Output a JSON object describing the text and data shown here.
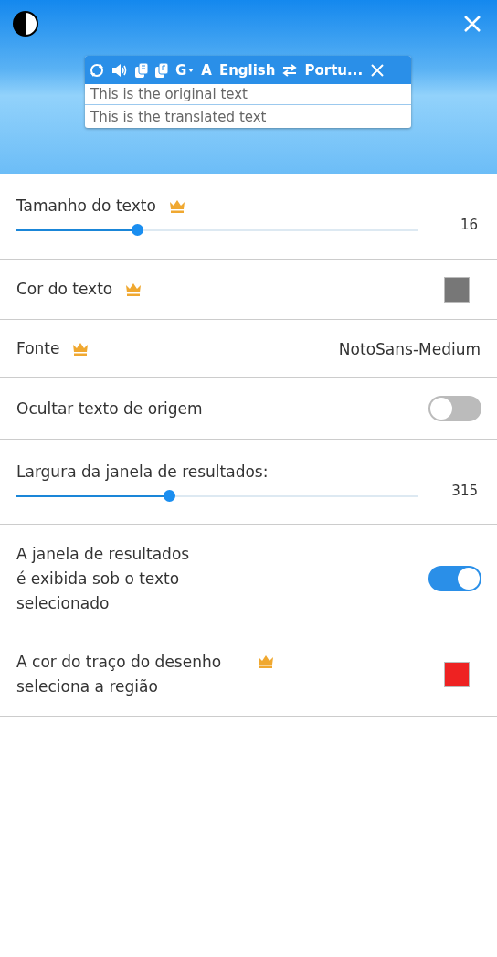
{
  "header": {
    "preview": {
      "toolbar": {
        "engine": "G",
        "font_button": "A",
        "source_language": "English",
        "target_language": "Portu..."
      },
      "original_text": "This is the original text",
      "translated_text": "This is the translated text"
    }
  },
  "settings": [
    {
      "kind": "slider",
      "label": "Tamanho do texto",
      "premium": true,
      "level": 0.3,
      "reading": "16"
    },
    {
      "kind": "color",
      "label": "Cor do texto",
      "premium": true,
      "color": "#777777"
    },
    {
      "kind": "value",
      "label": "Fonte",
      "premium": true,
      "value": "NotoSans-Medium"
    },
    {
      "kind": "toggle",
      "label": "Ocultar texto de origem",
      "premium": false,
      "on": false
    },
    {
      "kind": "slider",
      "label": "Largura da janela de resultados:",
      "premium": false,
      "level": 0.38,
      "reading": "315"
    },
    {
      "kind": "toggle",
      "label": "A janela de resultados\né exibida sob o texto\nselecionado",
      "premium": false,
      "on": true
    },
    {
      "kind": "color",
      "label": "A cor do traço do desenho\nseleciona a região",
      "premium": true,
      "color": "#ee2222"
    }
  ]
}
